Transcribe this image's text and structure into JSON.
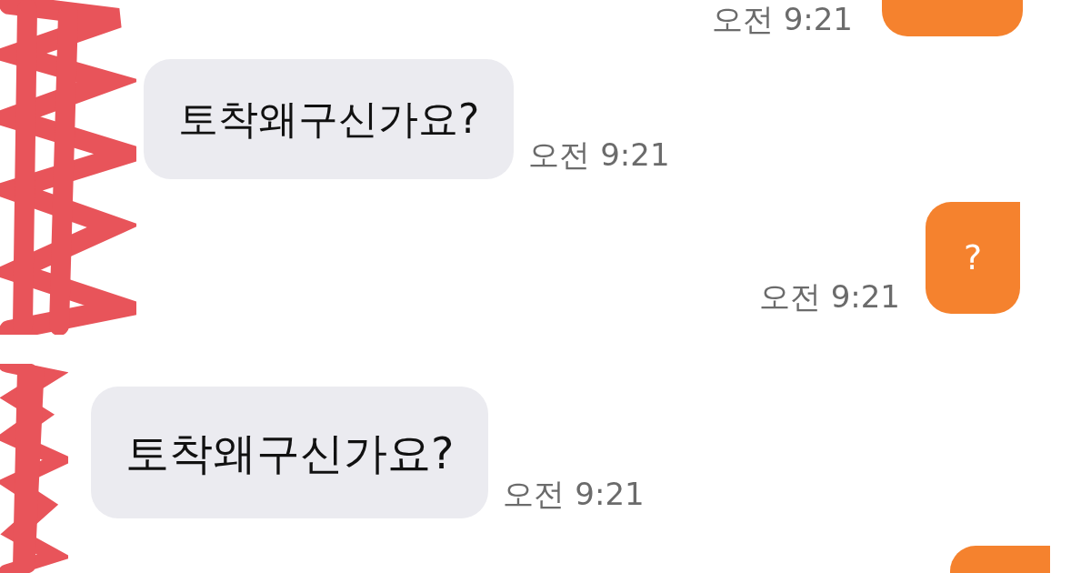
{
  "panels": [
    {
      "messages": [
        {
          "kind": "outgoing",
          "time": "오전 9:21"
        },
        {
          "kind": "incoming",
          "text": "토착왜구신가요?",
          "time": "오전 9:21"
        },
        {
          "kind": "outgoing",
          "text": "?",
          "time": "오전 9:21"
        }
      ]
    },
    {
      "messages": [
        {
          "kind": "incoming",
          "text": "토착왜구신가요?",
          "time": "오전 9:21"
        },
        {
          "kind": "outgoing"
        }
      ]
    }
  ]
}
